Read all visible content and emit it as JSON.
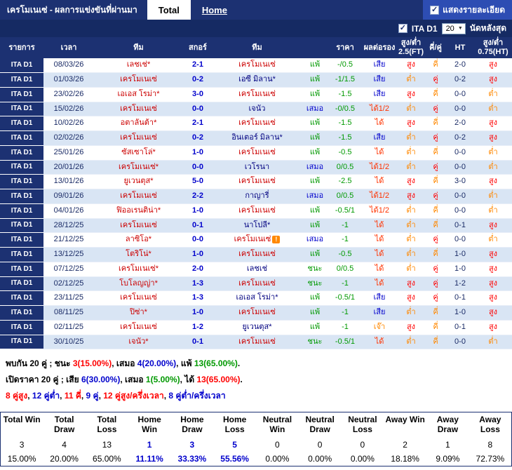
{
  "header": {
    "title": "เครโมเนเซ่ - ผลการแข่งขันที่ผ่านมา",
    "tabs": [
      {
        "label": "Total",
        "active": true
      },
      {
        "label": "Home",
        "active": false
      }
    ],
    "details_label": "แสดงรายละเอียด",
    "details_checked": true,
    "check_glyph": "✓"
  },
  "filter": {
    "league_label": "ITA D1",
    "league_checked": true,
    "matches_value": "20",
    "matches_suffix": "นัดหลังสุด",
    "check_glyph": "✓",
    "dropdown_arrow": "▼"
  },
  "table": {
    "col_headers": [
      "รายการ",
      "เวลา",
      "ทีม",
      "สกอร์",
      "ทีม",
      "",
      "ราคา",
      "ผลต่อรอง",
      "สูง/ต่ำ 2.5(FT)",
      "คี่/คู่",
      "HT",
      "สูง/ต่ำ 0.75(HT)"
    ],
    "rows": [
      {
        "league": "ITA D1",
        "date": "08/03/26",
        "home": "เลชเช่*",
        "score": "2-1",
        "away": "เครโมเนเซ่",
        "away_style": "red",
        "result": "แพ้",
        "result_style": "lose",
        "price": "-/0.5",
        "odds": "เสีย",
        "odds_style": "neg",
        "ou_ft": "สูง",
        "ou_ft_style": "over",
        "odd_even": "คี่",
        "odd_even_style": "odd",
        "ht": "2-0",
        "ou_ht": "สูง",
        "ou_ht_style": "over",
        "alert": false
      },
      {
        "league": "ITA D1",
        "date": "01/03/26",
        "home": "เครโมเนเซ่",
        "score": "0-2",
        "away": "เอซี มิลาน*",
        "away_style": "navy",
        "result": "แพ้",
        "result_style": "lose",
        "price": "-1/1.5",
        "odds": "เสีย",
        "odds_style": "neg",
        "ou_ft": "ต่ำ",
        "ou_ft_style": "under",
        "odd_even": "คู่",
        "odd_even_style": "even",
        "ht": "0-2",
        "ou_ht": "สูง",
        "ou_ht_style": "over",
        "alert": false
      },
      {
        "league": "ITA D1",
        "date": "23/02/26",
        "home": "เอเอส โรม่า*",
        "score": "3-0",
        "away": "เครโมเนเซ่",
        "away_style": "red",
        "result": "แพ้",
        "result_style": "lose",
        "price": "-1.5",
        "odds": "เสีย",
        "odds_style": "neg",
        "ou_ft": "สูง",
        "ou_ft_style": "over",
        "odd_even": "คี่",
        "odd_even_style": "odd",
        "ht": "0-0",
        "ou_ht": "ต่ำ",
        "ou_ht_style": "under",
        "alert": false
      },
      {
        "league": "ITA D1",
        "date": "15/02/26",
        "home": "เครโมเนเซ่",
        "score": "0-0",
        "away": "เจนัว",
        "away_style": "navy",
        "result": "เสมอ",
        "result_style": "draw",
        "price": "-0/0.5",
        "odds": "ได้1/2",
        "odds_style": "pos",
        "ou_ft": "ต่ำ",
        "ou_ft_style": "under",
        "odd_even": "คู่",
        "odd_even_style": "even",
        "ht": "0-0",
        "ou_ht": "ต่ำ",
        "ou_ht_style": "under",
        "alert": false
      },
      {
        "league": "ITA D1",
        "date": "10/02/26",
        "home": "อตาลันต้า*",
        "score": "2-1",
        "away": "เครโมเนเซ่",
        "away_style": "red",
        "result": "แพ้",
        "result_style": "lose",
        "price": "-1.5",
        "odds": "ได้",
        "odds_style": "pos",
        "ou_ft": "สูง",
        "ou_ft_style": "over",
        "odd_even": "คี่",
        "odd_even_style": "odd",
        "ht": "2-0",
        "ou_ht": "สูง",
        "ou_ht_style": "over",
        "alert": false
      },
      {
        "league": "ITA D1",
        "date": "02/02/26",
        "home": "เครโมเนเซ่",
        "score": "0-2",
        "away": "อินเตอร์ มิลาน*",
        "away_style": "navy",
        "result": "แพ้",
        "result_style": "lose",
        "price": "-1.5",
        "odds": "เสีย",
        "odds_style": "neg",
        "ou_ft": "ต่ำ",
        "ou_ft_style": "under",
        "odd_even": "คู่",
        "odd_even_style": "even",
        "ht": "0-2",
        "ou_ht": "สูง",
        "ou_ht_style": "over",
        "alert": false
      },
      {
        "league": "ITA D1",
        "date": "25/01/26",
        "home": "ซัสเซาโล่*",
        "score": "1-0",
        "away": "เครโมเนเซ่",
        "away_style": "red",
        "result": "แพ้",
        "result_style": "lose",
        "price": "-0.5",
        "odds": "ได้",
        "odds_style": "pos",
        "ou_ft": "ต่ำ",
        "ou_ft_style": "under",
        "odd_even": "คี่",
        "odd_even_style": "odd",
        "ht": "0-0",
        "ou_ht": "ต่ำ",
        "ou_ht_style": "under",
        "alert": false
      },
      {
        "league": "ITA D1",
        "date": "20/01/26",
        "home": "เครโมเนเซ่*",
        "score": "0-0",
        "away": "เวโรนา",
        "away_style": "navy",
        "result": "เสมอ",
        "result_style": "draw",
        "price": "0/0.5",
        "odds": "ได้1/2",
        "odds_style": "pos",
        "ou_ft": "ต่ำ",
        "ou_ft_style": "under",
        "odd_even": "คู่",
        "odd_even_style": "even",
        "ht": "0-0",
        "ou_ht": "ต่ำ",
        "ou_ht_style": "under",
        "alert": false
      },
      {
        "league": "ITA D1",
        "date": "13/01/26",
        "home": "ยูเวนตุส*",
        "score": "5-0",
        "away": "เครโมเนเซ่",
        "away_style": "red",
        "result": "แพ้",
        "result_style": "lose",
        "price": "-2.5",
        "odds": "ได้",
        "odds_style": "pos",
        "ou_ft": "สูง",
        "ou_ft_style": "over",
        "odd_even": "คี่",
        "odd_even_style": "odd",
        "ht": "3-0",
        "ou_ht": "สูง",
        "ou_ht_style": "over",
        "alert": false
      },
      {
        "league": "ITA D1",
        "date": "09/01/26",
        "home": "เครโมเนเซ่",
        "score": "2-2",
        "away": "กาญารี่",
        "away_style": "navy",
        "result": "เสมอ",
        "result_style": "draw",
        "price": "0/0.5",
        "odds": "ได้1/2",
        "odds_style": "pos",
        "ou_ft": "สูง",
        "ou_ft_style": "over",
        "odd_even": "คู่",
        "odd_even_style": "even",
        "ht": "0-0",
        "ou_ht": "ต่ำ",
        "ou_ht_style": "under",
        "alert": false
      },
      {
        "league": "ITA D1",
        "date": "04/01/26",
        "home": "ฟิออเรนติน่า*",
        "score": "1-0",
        "away": "เครโมเนเซ่",
        "away_style": "red",
        "result": "แพ้",
        "result_style": "lose",
        "price": "-0.5/1",
        "odds": "ได้1/2",
        "odds_style": "pos",
        "ou_ft": "ต่ำ",
        "ou_ft_style": "under",
        "odd_even": "คี่",
        "odd_even_style": "odd",
        "ht": "0-0",
        "ou_ht": "ต่ำ",
        "ou_ht_style": "under",
        "alert": false
      },
      {
        "league": "ITA D1",
        "date": "28/12/25",
        "home": "เครโมเนเซ่",
        "score": "0-1",
        "away": "นาโปลี*",
        "away_style": "navy",
        "result": "แพ้",
        "result_style": "lose",
        "price": "-1",
        "odds": "ได้",
        "odds_style": "pos",
        "ou_ft": "ต่ำ",
        "ou_ft_style": "under",
        "odd_even": "คี่",
        "odd_even_style": "odd",
        "ht": "0-1",
        "ou_ht": "สูง",
        "ou_ht_style": "over",
        "alert": false
      },
      {
        "league": "ITA D1",
        "date": "21/12/25",
        "home": "ลาซิโอ*",
        "score": "0-0",
        "away": "เครโมเนเซ่",
        "away_style": "red",
        "result": "เสมอ",
        "result_style": "draw",
        "price": "-1",
        "odds": "ได้",
        "odds_style": "pos",
        "ou_ft": "ต่ำ",
        "ou_ft_style": "under",
        "odd_even": "คู่",
        "odd_even_style": "even",
        "ht": "0-0",
        "ou_ht": "ต่ำ",
        "ou_ht_style": "under",
        "alert": true
      },
      {
        "league": "ITA D1",
        "date": "13/12/25",
        "home": "โตริโน่*",
        "score": "1-0",
        "away": "เครโมเนเซ่",
        "away_style": "red",
        "result": "แพ้",
        "result_style": "lose",
        "price": "-0.5",
        "odds": "ได้",
        "odds_style": "pos",
        "ou_ft": "ต่ำ",
        "ou_ft_style": "under",
        "odd_even": "คี่",
        "odd_even_style": "odd",
        "ht": "1-0",
        "ou_ht": "สูง",
        "ou_ht_style": "over",
        "alert": false
      },
      {
        "league": "ITA D1",
        "date": "07/12/25",
        "home": "เครโมเนเซ่*",
        "score": "2-0",
        "away": "เลชเช่",
        "away_style": "navy",
        "result": "ชนะ",
        "result_style": "win",
        "price": "0/0.5",
        "odds": "ได้",
        "odds_style": "pos",
        "ou_ft": "ต่ำ",
        "ou_ft_style": "under",
        "odd_even": "คู่",
        "odd_even_style": "even",
        "ht": "1-0",
        "ou_ht": "สูง",
        "ou_ht_style": "over",
        "alert": false
      },
      {
        "league": "ITA D1",
        "date": "02/12/25",
        "home": "โบโลญญ่า*",
        "score": "1-3",
        "away": "เครโมเนเซ่",
        "away_style": "red",
        "result": "ชนะ",
        "result_style": "win",
        "price": "-1",
        "odds": "ได้",
        "odds_style": "pos",
        "ou_ft": "สูง",
        "ou_ft_style": "over",
        "odd_even": "คู่",
        "odd_even_style": "even",
        "ht": "1-2",
        "ou_ht": "สูง",
        "ou_ht_style": "over",
        "alert": false
      },
      {
        "league": "ITA D1",
        "date": "23/11/25",
        "home": "เครโมเนเซ่",
        "score": "1-3",
        "away": "เอเอส โรม่า*",
        "away_style": "navy",
        "result": "แพ้",
        "result_style": "lose",
        "price": "-0.5/1",
        "odds": "เสีย",
        "odds_style": "neg",
        "ou_ft": "สูง",
        "ou_ft_style": "over",
        "odd_even": "คู่",
        "odd_even_style": "even",
        "ht": "0-1",
        "ou_ht": "สูง",
        "ou_ht_style": "over",
        "alert": false
      },
      {
        "league": "ITA D1",
        "date": "08/11/25",
        "home": "ปิซ่า*",
        "score": "1-0",
        "away": "เครโมเนเซ่",
        "away_style": "red",
        "result": "แพ้",
        "result_style": "lose",
        "price": "-1",
        "odds": "เสีย",
        "odds_style": "neg",
        "ou_ft": "ต่ำ",
        "ou_ft_style": "under",
        "odd_even": "คี่",
        "odd_even_style": "odd",
        "ht": "1-0",
        "ou_ht": "สูง",
        "ou_ht_style": "over",
        "alert": false
      },
      {
        "league": "ITA D1",
        "date": "02/11/25",
        "home": "เครโมเนเซ่",
        "score": "1-2",
        "away": "ยูเวนตุส*",
        "away_style": "navy",
        "result": "แพ้",
        "result_style": "lose",
        "price": "-1",
        "odds": "เจ๊า",
        "odds_style": "push",
        "ou_ft": "สูง",
        "ou_ft_style": "over",
        "odd_even": "คี่",
        "odd_even_style": "odd",
        "ht": "0-1",
        "ou_ht": "สูง",
        "ou_ht_style": "over",
        "alert": false
      },
      {
        "league": "ITA D1",
        "date": "30/10/25",
        "home": "เจนัว*",
        "score": "0-1",
        "away": "เครโมเนเซ่",
        "away_style": "red",
        "result": "ชนะ",
        "result_style": "win",
        "price": "-0.5/1",
        "odds": "ได้",
        "odds_style": "pos",
        "ou_ft": "ต่ำ",
        "ou_ft_style": "under",
        "odd_even": "คี่",
        "odd_even_style": "odd",
        "ht": "0-0",
        "ou_ht": "ต่ำ",
        "ou_ht_style": "under",
        "alert": false
      }
    ]
  },
  "summary_lines": [
    {
      "parts": [
        {
          "t": "พบกัน 20 คู่ ; ",
          "c": "plain"
        },
        {
          "t": "ชนะ ",
          "c": "plain"
        },
        {
          "t": "3(15.00%)",
          "c": "red"
        },
        {
          "t": ", ",
          "c": "plain"
        },
        {
          "t": "เสมอ ",
          "c": "plain"
        },
        {
          "t": "4(20.00%)",
          "c": "blue"
        },
        {
          "t": ", ",
          "c": "plain"
        },
        {
          "t": "แพ้ ",
          "c": "plain"
        },
        {
          "t": "13(65.00%)",
          "c": "green"
        },
        {
          "t": ".",
          "c": "plain"
        }
      ]
    },
    {
      "parts": [
        {
          "t": "เปิดราคา 20 คู่ ; ",
          "c": "plain"
        },
        {
          "t": "เสีย ",
          "c": "plain"
        },
        {
          "t": "6(30.00%)",
          "c": "blue"
        },
        {
          "t": ", ",
          "c": "plain"
        },
        {
          "t": "เสมอ ",
          "c": "plain"
        },
        {
          "t": "1(5.00%)",
          "c": "green"
        },
        {
          "t": ", ",
          "c": "plain"
        },
        {
          "t": "ได้ ",
          "c": "plain"
        },
        {
          "t": "13(65.00%)",
          "c": "red"
        },
        {
          "t": ".",
          "c": "plain"
        }
      ]
    },
    {
      "parts": [
        {
          "t": "8 คู่สูง",
          "c": "red"
        },
        {
          "t": ", ",
          "c": "plain"
        },
        {
          "t": "12 คู่ต่ำ",
          "c": "blue"
        },
        {
          "t": ", ",
          "c": "plain"
        },
        {
          "t": "11 คี่",
          "c": "red"
        },
        {
          "t": ", ",
          "c": "plain"
        },
        {
          "t": "9 คู่",
          "c": "blue"
        },
        {
          "t": ", ",
          "c": "plain"
        },
        {
          "t": "12 คู่สูง/ครึ่งเวลา",
          "c": "red"
        },
        {
          "t": ", ",
          "c": "plain"
        },
        {
          "t": "8 คู่ต่ำ/ครึ่งเวลา",
          "c": "blue"
        }
      ]
    }
  ],
  "totals": {
    "headers": [
      "Total Win",
      "Total Draw",
      "Total Loss",
      "Home Win",
      "Home Draw",
      "Home Loss",
      "Neutral Win",
      "Neutral Draw",
      "Neutral Loss",
      "Away Win",
      "Away Draw",
      "Away Loss"
    ],
    "values": [
      "3",
      "4",
      "13",
      "1",
      "3",
      "5",
      "0",
      "0",
      "0",
      "2",
      "1",
      "8"
    ],
    "percents": [
      "15.00%",
      "20.00%",
      "65.00%",
      "11.11%",
      "33.33%",
      "55.56%",
      "0.00%",
      "0.00%",
      "0.00%",
      "18.18%",
      "9.09%",
      "72.73%"
    ],
    "highlight_cols": [
      3,
      4,
      5
    ]
  }
}
